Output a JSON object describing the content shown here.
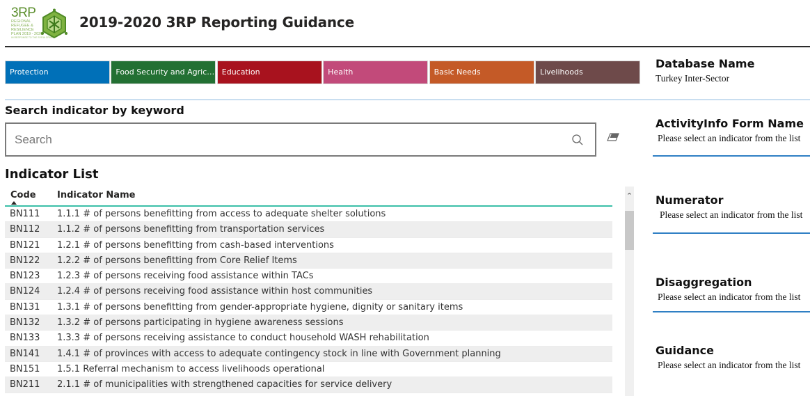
{
  "header": {
    "logo": {
      "big_text": "3RP",
      "lines": [
        "REGIONAL",
        "REFUGEE &",
        "RESILIENCE",
        "PLAN 2019 - 2020"
      ],
      "tagline": "IN RESPONSE TO THE SYRIA CRISIS"
    },
    "title": "2019-2020 3RP Reporting Guidance"
  },
  "tabs": [
    {
      "label": "Protection",
      "color": "#0070b8"
    },
    {
      "label": "Food Security and Agriculture",
      "color": "#237033"
    },
    {
      "label": "Education",
      "color": "#a8121e"
    },
    {
      "label": "Health",
      "color": "#c24a7a"
    },
    {
      "label": "Basic Needs",
      "color": "#c45a27"
    },
    {
      "label": "Livelihoods",
      "color": "#6e4a4a"
    }
  ],
  "search": {
    "label": "Search indicator by keyword",
    "placeholder": "Search",
    "value": ""
  },
  "indicator_list": {
    "title": "Indicator List",
    "columns": {
      "code": "Code",
      "name": "Indicator Name"
    },
    "sort": {
      "column": "code",
      "direction": "ascending"
    },
    "rows": [
      {
        "code": "BN111",
        "name": "1.1.1 # of persons benefitting from access to adequate shelter solutions"
      },
      {
        "code": "BN112",
        "name": "1.1.2 # of persons benefitting from transportation services"
      },
      {
        "code": "BN121",
        "name": "1.2.1 # of persons benefitting from cash-based interventions"
      },
      {
        "code": "BN122",
        "name": "1.2.2 # of persons benefitting from Core Relief Items"
      },
      {
        "code": "BN123",
        "name": "1.2.3 # of persons receiving food assistance within TACs"
      },
      {
        "code": "BN124",
        "name": "1.2.4 # of persons receiving food assistance within host communities"
      },
      {
        "code": "BN131",
        "name": "1.3.1 # of persons benefitting from gender-appropriate hygiene, dignity or sanitary items"
      },
      {
        "code": "BN132",
        "name": "1.3.2 # of persons participating in hygiene awareness sessions"
      },
      {
        "code": "BN133",
        "name": "1.3.3 # of persons receiving assistance to conduct household WASH rehabilitation"
      },
      {
        "code": "BN141",
        "name": "1.4.1 # of provinces with access to adequate contingency stock in line with Government planning"
      },
      {
        "code": "BN151",
        "name": "1.5.1 Referral mechanism to access livelihoods operational"
      },
      {
        "code": "BN211",
        "name": "2.1.1 # of municipalities with strengthened capacities for service delivery"
      }
    ]
  },
  "panel": {
    "database": {
      "title": "Database Name",
      "value": "Turkey Inter-Sector"
    },
    "form": {
      "title": "ActivityInfo Form Name",
      "value": "Please select an indicator from the list"
    },
    "numerator": {
      "title": "Numerator",
      "value": "Please select an indicator from the list"
    },
    "disaggregation": {
      "title": "Disaggregation",
      "value": "Please select an indicator from the list"
    },
    "guidance": {
      "title": "Guidance",
      "value": "Please select an indicator from the list"
    }
  }
}
